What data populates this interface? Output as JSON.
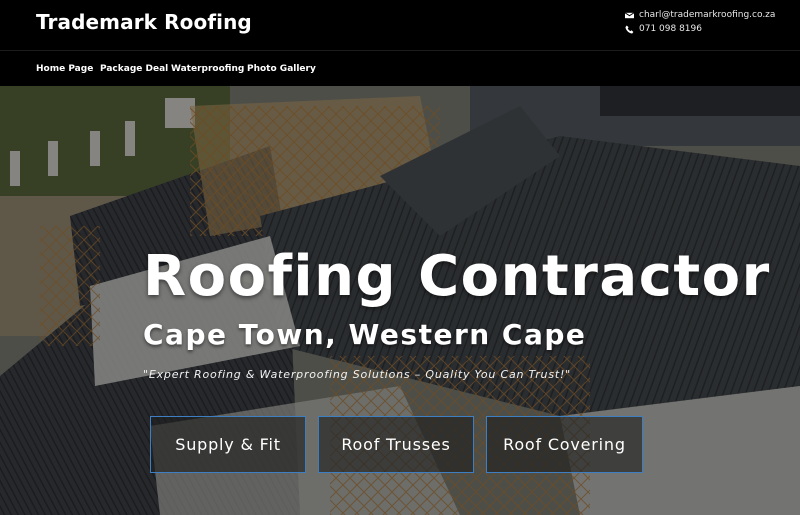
{
  "header": {
    "site_title": "Trademark Roofing",
    "email": "charl@trademarkroofing.co.za",
    "phone": "071 098 8196",
    "icons": {
      "email": "envelope-icon",
      "phone": "phone-icon"
    }
  },
  "nav": {
    "items": [
      {
        "label": "Home Page"
      },
      {
        "label": "Package Deal"
      },
      {
        "label": "Waterproofing"
      },
      {
        "label": "Photo Gallery"
      }
    ]
  },
  "hero": {
    "title": "Roofing Contractor",
    "subtitle": "Cape Town, Western Cape",
    "tagline": "\"Expert Roofing & Waterproofing Solutions – Quality You Can Trust!\"",
    "buttons": [
      {
        "label": "Supply & Fit"
      },
      {
        "label": "Roof Trusses"
      },
      {
        "label": "Roof Covering"
      }
    ]
  },
  "colors": {
    "header_bg": "#000000",
    "button_border": "#3d7fc2"
  }
}
